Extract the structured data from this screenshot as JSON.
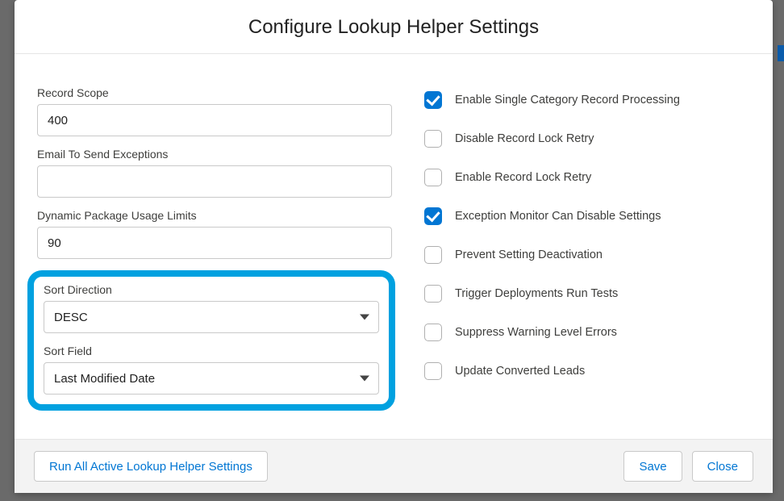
{
  "modal": {
    "title": "Configure Lookup Helper Settings"
  },
  "fields": {
    "recordScope": {
      "label": "Record Scope",
      "value": "400"
    },
    "emailExceptions": {
      "label": "Email To Send Exceptions",
      "value": ""
    },
    "dynamicLimits": {
      "label": "Dynamic Package Usage Limits",
      "value": "90"
    },
    "sortDirection": {
      "label": "Sort Direction",
      "value": "DESC"
    },
    "sortField": {
      "label": "Sort Field",
      "value": "Last Modified Date"
    }
  },
  "checkboxes": [
    {
      "label": "Enable Single Category Record Processing",
      "checked": true
    },
    {
      "label": "Disable Record Lock Retry",
      "checked": false
    },
    {
      "label": "Enable Record Lock Retry",
      "checked": false
    },
    {
      "label": "Exception Monitor Can Disable Settings",
      "checked": true
    },
    {
      "label": "Prevent Setting Deactivation",
      "checked": false
    },
    {
      "label": "Trigger Deployments Run Tests",
      "checked": false
    },
    {
      "label": "Suppress Warning Level Errors",
      "checked": false
    },
    {
      "label": "Update Converted Leads",
      "checked": false
    }
  ],
  "footer": {
    "runAll": "Run All Active Lookup Helper Settings",
    "save": "Save",
    "close": "Close"
  }
}
